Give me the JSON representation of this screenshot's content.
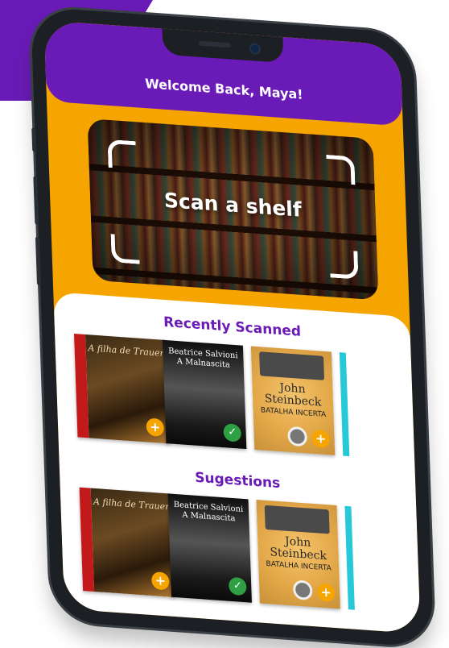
{
  "header": {
    "welcome_text": "Welcome Back, Maya!"
  },
  "scanner": {
    "label": "Scan a shelf"
  },
  "recently_scanned": {
    "title": "Recently Scanned",
    "books": [
      {
        "title": "A filha de Trauer",
        "action": "add"
      },
      {
        "title": "Beatrice Salvioni\nA Malnascita",
        "action": "added"
      },
      {
        "author": "John Steinbeck",
        "title": "BATALHA INCERTA",
        "action": "add"
      }
    ]
  },
  "suggestions": {
    "title": "Sugestions",
    "books": [
      {
        "title": "A filha de Trauer",
        "action": "add"
      },
      {
        "title": "Beatrice Salvioni\nA Malnascita",
        "action": "added"
      },
      {
        "author": "John Steinbeck",
        "title": "BATALHA INCERTA",
        "action": "add"
      }
    ]
  },
  "icons": {
    "add": "+",
    "added": "✓"
  },
  "colors": {
    "purple": "#6a1bb7",
    "orange": "#f6a400",
    "green": "#2ea043",
    "teal": "#27c8d8"
  }
}
